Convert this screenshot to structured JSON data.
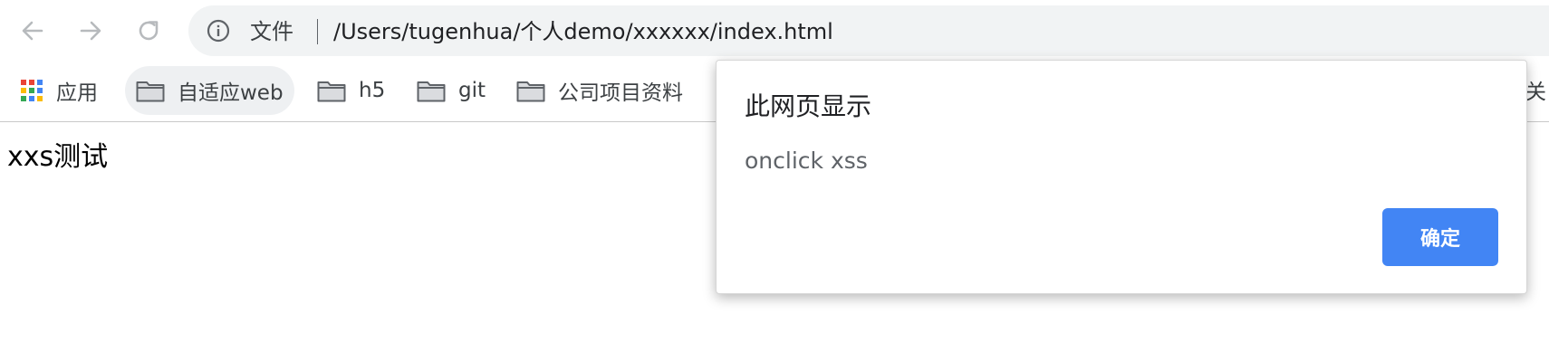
{
  "toolbar": {
    "back_icon": "arrow-left-icon",
    "forward_icon": "arrow-right-icon",
    "reload_icon": "reload-icon"
  },
  "omnibox": {
    "info_icon": "info-icon",
    "scheme_label": "文件",
    "url": "/Users/tugenhua/个人demo/xxxxxx/index.html"
  },
  "bookmarks": {
    "apps_label": "应用",
    "items": [
      {
        "label": "自适应web",
        "icon": "folder-icon"
      },
      {
        "label": "h5",
        "icon": "folder-icon"
      },
      {
        "label": "git",
        "icon": "folder-icon"
      },
      {
        "label": "公司项目资料",
        "icon": "folder-icon"
      }
    ],
    "overflow_label": "关"
  },
  "page": {
    "text": "xxs测试"
  },
  "dialog": {
    "title": "此网页显示",
    "message": "onclick xss",
    "ok_label": "确定",
    "accent_color": "#4285f4"
  }
}
